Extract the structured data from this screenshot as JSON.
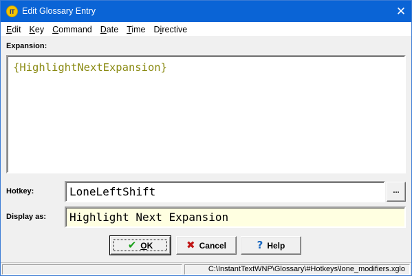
{
  "window": {
    "title": "Edit Glossary Entry",
    "app_icon_text": "IT",
    "close_glyph": "✕"
  },
  "menu": {
    "items": [
      {
        "label_prefix": "",
        "accel": "E",
        "label_rest": "dit"
      },
      {
        "label_prefix": "",
        "accel": "K",
        "label_rest": "ey"
      },
      {
        "label_prefix": "",
        "accel": "C",
        "label_rest": "ommand"
      },
      {
        "label_prefix": "",
        "accel": "D",
        "label_rest": "ate"
      },
      {
        "label_prefix": "",
        "accel": "T",
        "label_rest": "ime"
      },
      {
        "label_prefix": "D",
        "accel": "i",
        "label_rest": "rective"
      }
    ]
  },
  "expansion": {
    "label": "Expansion:",
    "value": "{HighlightNextExpansion}",
    "text_color": "#8a8a12"
  },
  "hotkey": {
    "label": "Hotkey:",
    "value": "LoneLeftShift",
    "browse_label": "..."
  },
  "display": {
    "label": "Display as:",
    "value": "Highlight Next Expansion",
    "background_color": "#ffffe1"
  },
  "buttons": {
    "ok": {
      "accel": "O",
      "rest": "K",
      "icon": "checkmark-icon"
    },
    "cancel": {
      "label": "Cancel",
      "icon": "x-mark-icon"
    },
    "help": {
      "label": "Help",
      "icon": "question-mark-icon"
    }
  },
  "status": {
    "left": "",
    "path": "C:\\InstantTextWNP\\Glossary\\#Hotkeys\\lone_modifiers.xglo"
  },
  "colors": {
    "titlebar": "#0a64d6",
    "accent": "#0a64d6"
  }
}
